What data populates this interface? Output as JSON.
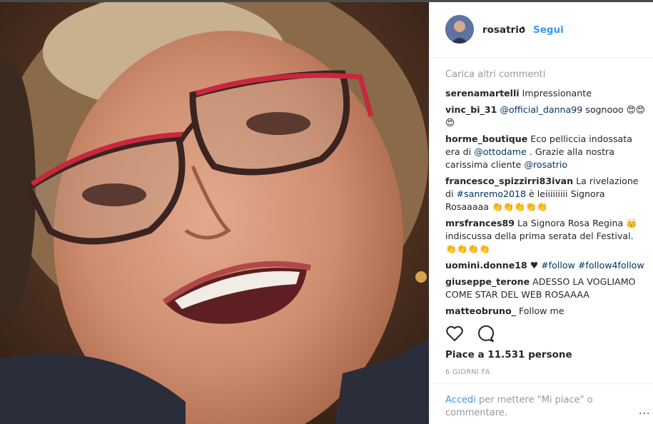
{
  "post": {
    "author": "rosatrio",
    "separator": "•",
    "follow_label": "Segui",
    "load_more": "Carica altri commenti",
    "comments": [
      {
        "user": "serenamartelli",
        "text": " Impressionante"
      },
      {
        "user": "vinc_bi_31",
        "text": " @official_danna99 sognooo 😍😍😍"
      },
      {
        "user": "horme_boutique",
        "text": " Eco pelliccia indossata era di @ottodame . Grazie alla nostra carissima cliente @rosatrio"
      },
      {
        "user": "francesco_spizzirri83ivan",
        "text": " La rivelazione di #sanremo2018 è leiiiiiiiii Signora Rosaaaaa 👏👏👏👏👏"
      },
      {
        "user": "mrsfrances89",
        "text": " La Signora Rosa Regina 👑 indiscussa della prima serata del Festival. 👏👏👏👏"
      },
      {
        "user": "uomini.donne18",
        "text": " ♥ #follow #follow4follow"
      },
      {
        "user": "giuseppe_terone",
        "text": " ADESSO LA VOGLIAMO COME STAR DEL WEB ROSAAAA"
      },
      {
        "user": "matteobruno_",
        "text": " Follow me"
      }
    ],
    "likes": "Piace a 11.531 persone",
    "age": "6 GIORNI FA",
    "login_link": "Accedi",
    "login_rest": " per mettere \"Mi piace\" o commentare.",
    "more_glyph": "..."
  },
  "icons": {
    "like": "heart-icon",
    "comment": "comment-icon",
    "more": "more-options-icon"
  },
  "colors": {
    "accent": "#3897f0",
    "link": "#003569",
    "muted": "#999999",
    "text": "#262626"
  }
}
